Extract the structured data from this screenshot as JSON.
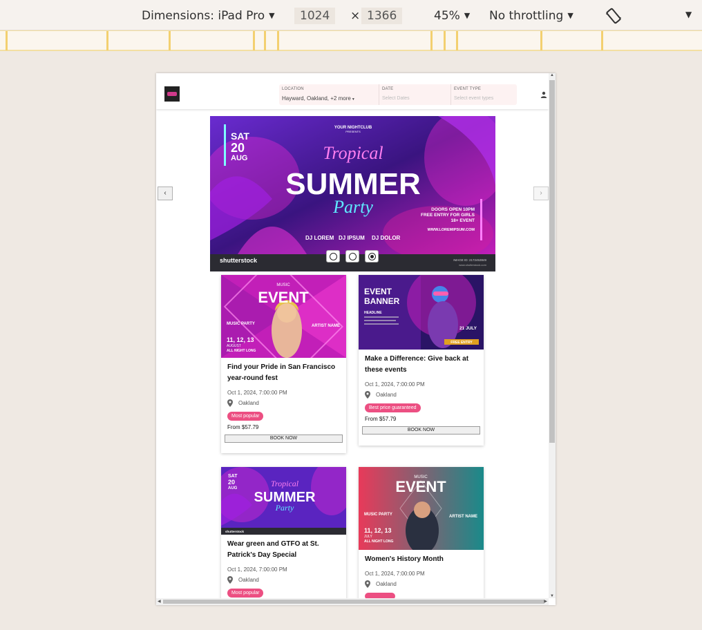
{
  "devtools": {
    "dimensions_label": "Dimensions: iPad Pro",
    "width": "1024",
    "times": "×",
    "height": "1366",
    "zoom": "45%",
    "throttling": "No throttling"
  },
  "header": {
    "location_label": "LOCATION",
    "location_value": "Hayward, Oakland, +2 more",
    "date_label": "DATE",
    "date_placeholder": "Select Dates",
    "event_type_label": "EVENT TYPE",
    "event_type_placeholder": "Select event types"
  },
  "carousel": {
    "prev_icon": "‹",
    "next_icon": "›",
    "slides": 3,
    "active_slide": 3,
    "slide_text": {
      "club": "YOUR NIGHTCLUB",
      "presents": "PRESENTS",
      "day": "SAT",
      "date_num": "20",
      "month": "AUG",
      "script1": "Tropical",
      "main": "SUMMER",
      "script2": "Party",
      "info1": "DOORS OPEN 10PM",
      "info2": "FREE ENTRY FOR GIRLS",
      "info3": "18+ EVENT",
      "url": "WWW.LOREMIPSUM.COM",
      "dj1": "DJ LOREM",
      "dj2": "DJ IPSUM",
      "dj3": "DJ DOLOR",
      "watermark": "shutterstock",
      "image_id": "IMAGE ID: 2172453849",
      "site": "www.shutterstock.com"
    }
  },
  "cards": [
    {
      "title": "Find your Pride in San Francisco year-round fest",
      "date": "Oct 1, 2024, 7:00:00 PM",
      "location": "Oakland",
      "badge": "Most popular",
      "price": "From $57.79",
      "button": "BOOK NOW",
      "poster": {
        "top": "MUSIC",
        "main": "EVENT",
        "sub": "MUSIC PARTY",
        "dates": "11, 12, 13",
        "month": "AUGUST",
        "tag": "ALL NIGHT LONG",
        "artist": "ARTIST NAME"
      }
    },
    {
      "title": "Make a Difference: Give back at these events",
      "date": "Oct 1, 2024, 7:00:00 PM",
      "location": "Oakland",
      "badge": "Best price guaranteed",
      "price": "From $57.79",
      "button": "BOOK NOW",
      "poster": {
        "main1": "EVENT",
        "main2": "BANNER",
        "headline": "HEADLINE",
        "date": "21 JULY",
        "tag": "FREE ENTRY"
      }
    },
    {
      "title": "Wear green and GTFO at St. Patrick's Day Special",
      "date": "Oct 1, 2024, 7:00:00 PM",
      "location": "Oakland",
      "badge": "Most popular",
      "poster": {
        "day": "SAT",
        "date_num": "20",
        "month": "AUG",
        "script1": "Tropical",
        "main": "SUMMER",
        "script2": "Party",
        "watermark": "shutterstock"
      }
    },
    {
      "title": "Women's History Month",
      "date": "Oct 1, 2024, 7:00:00 PM",
      "location": "Oakland",
      "poster": {
        "top": "MUSIC",
        "main": "EVENT",
        "sub": "MUSIC PARTY",
        "dates": "11, 12, 13",
        "month": "JULY",
        "tag": "ALL NIGHT LONG",
        "artist": "ARTIST NAME"
      }
    }
  ],
  "colors": {
    "accent_pink": "#ec4f82",
    "poster_magenta": "#c21fb8",
    "poster_purple": "#4a1a8c"
  }
}
